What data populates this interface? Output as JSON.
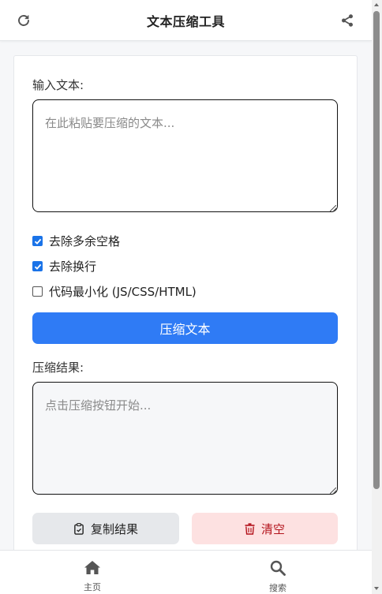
{
  "header": {
    "title": "文本压缩工具",
    "left_icon": "refresh-icon",
    "right_icon": "share-icon"
  },
  "input": {
    "label": "输入文本:",
    "placeholder": "在此粘贴要压缩的文本...",
    "value": ""
  },
  "options": [
    {
      "label": "去除多余空格",
      "checked": true
    },
    {
      "label": "去除换行",
      "checked": true
    },
    {
      "label": "代码最小化 (JS/CSS/HTML)",
      "checked": false
    }
  ],
  "compress_button": {
    "label": "压缩文本"
  },
  "output": {
    "label": "压缩结果:",
    "placeholder": "点击压缩按钮开始...",
    "value": ""
  },
  "actions": {
    "copy": {
      "label": "复制结果",
      "icon": "clipboard-icon"
    },
    "clear": {
      "label": "清空",
      "icon": "trash-icon"
    }
  },
  "nav": [
    {
      "label": "主页",
      "icon": "home-icon"
    },
    {
      "label": "搜索",
      "icon": "search-icon"
    }
  ],
  "colors": {
    "primary": "#2f7bf5",
    "checkbox": "#1a73e8",
    "danger_bg": "#fde1e1",
    "danger_text": "#b3121b",
    "secondary_bg": "#e6e8eb",
    "nav_icon": "#555555"
  }
}
